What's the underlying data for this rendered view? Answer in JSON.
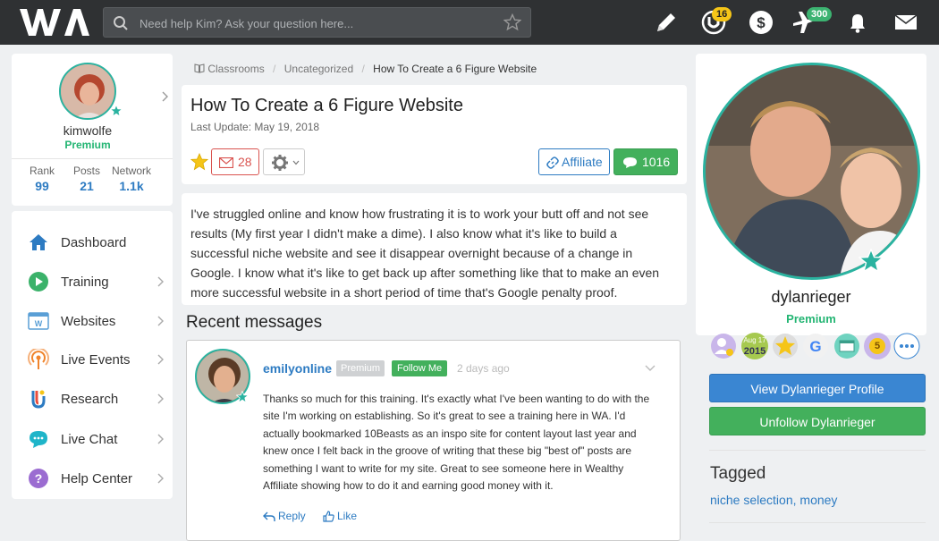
{
  "header": {
    "search_placeholder": "Need help Kim? Ask your question here...",
    "university_count": "16",
    "airplane_count": "300"
  },
  "profile": {
    "username": "kimwolfe",
    "membership": "Premium",
    "stats": [
      {
        "label": "Rank",
        "value": "99"
      },
      {
        "label": "Posts",
        "value": "21"
      },
      {
        "label": "Network",
        "value": "1.1k"
      }
    ]
  },
  "sidebar": {
    "items": [
      {
        "label": "Dashboard",
        "icon": "home-icon"
      },
      {
        "label": "Training",
        "icon": "play-icon"
      },
      {
        "label": "Websites",
        "icon": "website-icon"
      },
      {
        "label": "Live Events",
        "icon": "broadcast-icon"
      },
      {
        "label": "Research",
        "icon": "research-icon"
      },
      {
        "label": "Live Chat",
        "icon": "chat-icon"
      },
      {
        "label": "Help Center",
        "icon": "help-icon"
      }
    ]
  },
  "breadcrumb": {
    "items": [
      "Classrooms",
      "Uncategorized",
      "How To Create a 6 Figure Website"
    ]
  },
  "article": {
    "title": "How To Create a 6 Figure Website",
    "last_update": "Last Update: May 19, 2018",
    "mail_count": "28",
    "affiliate_label": "Affiliate",
    "comment_count": "1016",
    "body": "I've struggled online and know how frustrating it is to work your butt off and not see results (My first year I didn't make a dime). I also know what it's like to build a successful niche website and see it disappear overnight because of a change in Google. I know what it's like to get back up after something like that to make an even more successful website in a short period of time that's Google penalty proof."
  },
  "recent": {
    "heading": "Recent messages",
    "message": {
      "user": "emilyonline",
      "membership": "Premium",
      "follow_label": "Follow Me",
      "time": "2 days ago",
      "text": "Thanks so much for this training. It's exactly what I've been wanting to do with the site I'm working on establishing. So it's great to see a training here in WA. I'd actually bookmarked 10Beasts as an inspo site for content layout last year and knew once I felt back in the groove of writing that these big \"best of\" posts are something I want to write for my site. Great to see someone here in Wealthy Affiliate showing how to do it and earning good money with it.",
      "reply_label": "Reply",
      "like_label": "Like"
    }
  },
  "author": {
    "username": "dylanrieger",
    "membership": "Premium",
    "badges": [
      "ambassador-badge",
      "member-since-badge",
      "star-badge",
      "google-badge",
      "site-badge",
      "rank-badge",
      "more-badge"
    ],
    "badge_year_label": "2015",
    "badge_month_label": "Aug 17",
    "badge_rank_label": "5",
    "view_profile_label": "View Dylanrieger Profile",
    "unfollow_label": "Unfollow Dylanrieger",
    "tagged_heading": "Tagged",
    "tags": [
      "niche selection",
      "money"
    ]
  },
  "colors": {
    "topbar": "#2f3133",
    "premium_green": "#23b573",
    "link_blue": "#2d7bc2",
    "button_green": "#43b05c",
    "button_blue": "#3a86d2",
    "avatar_ring": "#2ab3a0"
  }
}
